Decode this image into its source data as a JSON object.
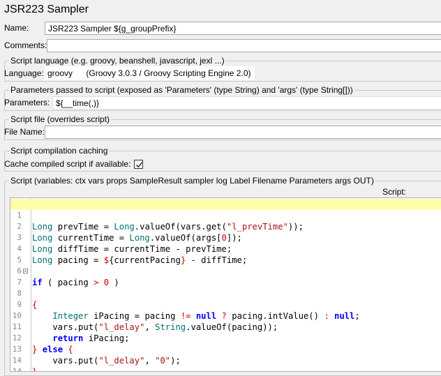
{
  "sampler_title": "JSR223 Sampler",
  "name": {
    "label": "Name:",
    "value": "JSR223 Sampler ${g_groupPrefix}"
  },
  "comments": {
    "label": "Comments:",
    "value": ""
  },
  "language_group": {
    "title": "Script language (e.g. groovy, beanshell, javascript, jexl ...)",
    "label": "Language:",
    "value": "groovy",
    "description": "(Groovy 3.0.3 / Groovy Scripting Engine 2.0)"
  },
  "parameters_group": {
    "title": "Parameters passed to script (exposed as 'Parameters' (type String) and 'args' (type String[]))",
    "label": "Parameters:",
    "value": "${__time(,)}"
  },
  "script_file_group": {
    "title": "Script file (overrides script)",
    "label": "File Name:",
    "value": ""
  },
  "caching_group": {
    "title": "Script compilation caching",
    "label": "Cache compiled script if available:",
    "checked": true
  },
  "script_group": {
    "title": "Script (variables: ctx vars props SampleResult sampler log Label Filename Parameters args OUT)",
    "script_label": "Script:"
  },
  "code": {
    "line_numbers": [
      "1",
      "2",
      "3",
      "4",
      "5",
      "6",
      "7",
      "8",
      "9",
      "10",
      "11",
      "12",
      "13",
      "14"
    ],
    "highlighted_line": 1,
    "fold_line": 7
  }
}
